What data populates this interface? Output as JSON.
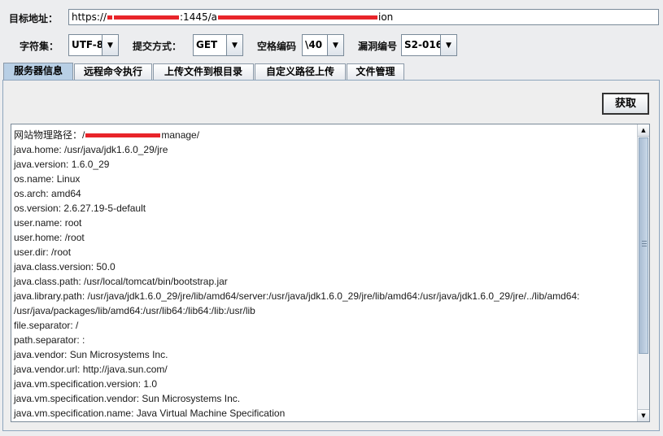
{
  "form": {
    "target_label": "目标地址：",
    "url_prefix": "https://",
    "url_mid": ":1445/a",
    "url_suffix": "ion",
    "charset_label": "字符集：",
    "charset_value": "UTF-8",
    "method_label": "提交方式：",
    "method_value": "GET",
    "space_label": "空格编码",
    "space_value": "\\40",
    "vuln_label": "漏洞编号",
    "vuln_value": "S2-016"
  },
  "tabs": [
    {
      "label": "服务器信息"
    },
    {
      "label": "远程命令执行"
    },
    {
      "label": "上传文件到根目录"
    },
    {
      "label": "自定义路径上传"
    },
    {
      "label": "文件管理"
    }
  ],
  "fetch_button": "获取",
  "output": {
    "path_label": "网站物理路径：/",
    "path_suffix": "manage/",
    "lines": [
      "java.home: /usr/java/jdk1.6.0_29/jre",
      "java.version: 1.6.0_29",
      "os.name: Linux",
      "os.arch: amd64",
      "os.version: 2.6.27.19-5-default",
      "user.name: root",
      "user.home: /root",
      "user.dir: /root",
      "java.class.version: 50.0",
      "java.class.path: /usr/local/tomcat/bin/bootstrap.jar",
      "java.library.path: /usr/java/jdk1.6.0_29/jre/lib/amd64/server:/usr/java/jdk1.6.0_29/jre/lib/amd64:/usr/java/jdk1.6.0_29/jre/../lib/amd64:",
      "/usr/java/packages/lib/amd64:/usr/lib64:/lib64:/lib:/usr/lib",
      "file.separator: /",
      "path.separator: :",
      "java.vendor: Sun Microsystems Inc.",
      "java.vendor.url: http://java.sun.com/",
      "java.vm.specification.version: 1.0",
      "java.vm.specification.vendor: Sun Microsystems Inc.",
      "java.vm.specification.name: Java Virtual Machine Specification"
    ]
  },
  "icons": {
    "dropdown": "chevron-down-icon",
    "scroll_up": "arrow-up-icon",
    "scroll_down": "arrow-down-icon"
  },
  "colors": {
    "redaction": "#e8242a",
    "active_tab": "#b8cfe5"
  }
}
